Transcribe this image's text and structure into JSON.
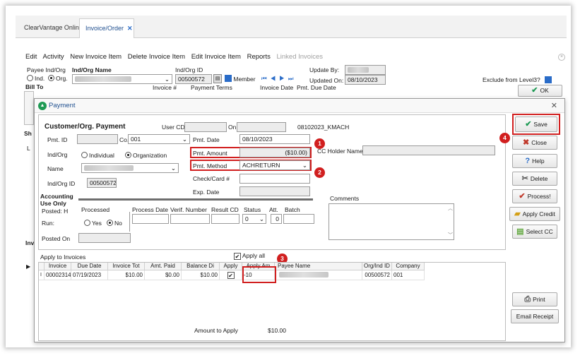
{
  "tabs": [
    {
      "label": "ClearVantage Online"
    },
    {
      "label": "Invoice/Order",
      "close": "✕"
    }
  ],
  "menu": {
    "edit": "Edit",
    "activity": "Activity",
    "new_invoice_item": "New Invoice Item",
    "delete_invoice_item": "Delete Invoice Item",
    "edit_invoice_item": "Edit Invoice Item",
    "reports": "Reports",
    "linked_invoices": "Linked Invoices"
  },
  "bg": {
    "payee_label": "Payee Ind/Org",
    "ind_label": "Ind.",
    "org_label": "Org.",
    "name_label": "Ind/Org Name",
    "id_label": "Ind/Org ID",
    "id_value": "00500572",
    "member_label": "Member",
    "update_by_label": "Update By:",
    "updated_on_label": "Updated On:",
    "updated_on_value": "08/10/2023",
    "exclude_label": "Exclude from Level3?",
    "ok_label": "OK",
    "bill_to": "Bill To",
    "invoice_num_label": "Invoice #",
    "payment_terms_label": "Payment Terms",
    "invoice_date_label": "Invoice Date",
    "pmt_due_label": "Pmt. Due Date",
    "side_sh": "Sh",
    "side_l": "L",
    "side_inv": "Inv"
  },
  "dialog": {
    "title": "Payment",
    "heading": "Customer/Org. Payment",
    "user_cd_label": "User CD",
    "on_label": "On",
    "batch_code": "08102023_KMACH",
    "pmt_id_label": "Pmt. ID",
    "co_label": "Co.",
    "co_value": "001",
    "ind_org_label": "Ind/Org",
    "individual_label": "Individual",
    "organization_label": "Organization",
    "name_label": "Name",
    "ind_org_id_label": "Ind/Org ID",
    "ind_org_id_value": "00500572",
    "pmt_date_label": "Pmt. Date",
    "pmt_date_value": "08/10/2023",
    "pmt_amount_label": "Pmt. Amount",
    "pmt_amount_value": "($10.00)",
    "pmt_method_label": "Pmt. Method",
    "pmt_method_value": "ACHRETURN",
    "check_card_label": "Check/Card #",
    "exp_date_label": "Exp. Date",
    "cc_holder_label": "CC Holder Name",
    "comments_label": "Comments",
    "accounting_label": "Accounting Use Only",
    "posted_label": "Posted: H",
    "run_label": "Run:",
    "posted_on_label": "Posted On",
    "processed_label": "Processed",
    "yes_label": "Yes",
    "no_label": "No",
    "process_date_label": "Process Date",
    "verif_number_label": "Verif. Number",
    "result_cd_label": "Result CD",
    "status_label": "Status",
    "status_value": "0",
    "att_label": "Att.",
    "att_value": "0",
    "batch_label": "Batch",
    "apply_to_label": "Apply to Invoices",
    "apply_all_label": "Apply all",
    "amount_to_apply_label": "Amount to Apply",
    "amount_to_apply_value": "$10.00"
  },
  "grid": {
    "headers": [
      "Invoice",
      "Due Date",
      "Invoice Tot",
      "Amt. Paid",
      "Balance Di",
      "Apply",
      "Apply Am",
      "Payee Name",
      "Org/Ind ID",
      "Company"
    ],
    "row": {
      "invoice": "00002314",
      "due_date": "07/19/2023",
      "invoice_tot": "$10.00",
      "amt_paid": "$0.00",
      "balance": "$10.00",
      "apply_amount": "-10",
      "org_ind_id": "00500572",
      "company": "001"
    }
  },
  "buttons": {
    "save": "Save",
    "close": "Close",
    "help": "Help",
    "delete": "Delete",
    "process": "Process!",
    "apply_credit": "Apply Credit",
    "select_cc": "Select CC",
    "print": "Print",
    "email_receipt": "Email Receipt"
  },
  "badges": [
    "1",
    "2",
    "3",
    "4"
  ],
  "colors": {
    "accent": "#1f4f8f",
    "highlight": "#d11f1f",
    "payment_icon": "#1e9a54"
  }
}
